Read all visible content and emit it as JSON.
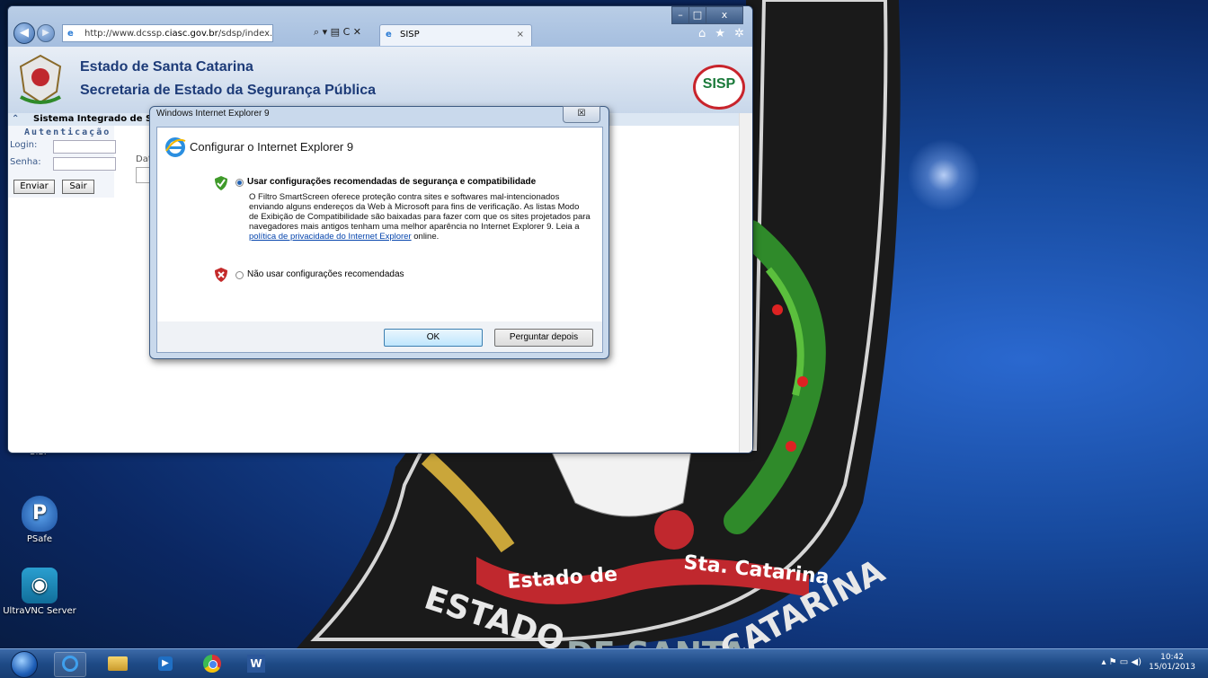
{
  "browser": {
    "url_prefix": "http://www.dcssp.",
    "url_domain": "ciasc.gov.br",
    "url_path": "/sdsp/index.asp",
    "addr_controls": "⌕ ▾ ▤ C ✕",
    "tab_title": "SISP",
    "tab_close": "×",
    "win_min": "–",
    "win_max": "□",
    "win_close": "x",
    "toolbar_icons": "⌂ ★ ✲"
  },
  "page": {
    "title1": "Estado de Santa Catarina",
    "title2": "Secretaria de Estado da Segurança Pública",
    "logo_text": "SISP",
    "system_bar": "Sistema Integrado de S",
    "auth_heading": "Autenticação",
    "login_label": "Login:",
    "senha_label": "Senha:",
    "enviar": "Enviar",
    "sair": "Sair",
    "dat_label": "Dat"
  },
  "dialog": {
    "window_title": "Windows Internet Explorer 9",
    "close": "☒",
    "heading": "Configurar o Internet Explorer 9",
    "option1_label": "Usar configurações recomendadas de segurança e compatibilidade",
    "option1_desc": "O Filtro SmartScreen oferece proteção contra sites e softwares mal-intencionados enviando alguns endereços da Web à Microsoft para fins de verificação. As listas Modo de Exibição de Compatibilidade são baixadas para fazer com que os sites projetados para navegadores mais antigos tenham uma melhor aparência no Internet Explorer 9. Leia a",
    "option1_link": "política de privacidade do Internet Explorer",
    "option1_after": "online.",
    "option2_label": "Não usar configurações recomendadas",
    "ok": "OK",
    "ask_later": "Perguntar depois"
  },
  "desktop": {
    "icons": [
      {
        "label": "SISP"
      },
      {
        "label": "PSafe"
      },
      {
        "label": "UltraVNC Server"
      }
    ],
    "ribbon_left": "Estado de",
    "ribbon_right": "Sta. Catarina",
    "arc_text_left": "ESTADO",
    "arc_text_mid": "DE SANTA",
    "arc_text_right": "CATARINA"
  },
  "taskbar": {
    "time": "10:42",
    "date": "15/01/2013",
    "tray_icons": "▴  ⚑  ▭  ◀)"
  },
  "colors": {
    "accent_red": "#c0282e",
    "arrow": "#c9373a",
    "link": "#0645ad"
  }
}
